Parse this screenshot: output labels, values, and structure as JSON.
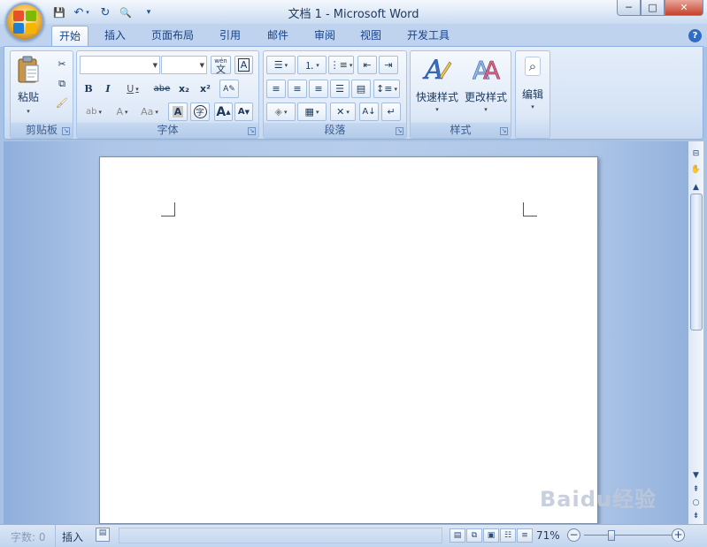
{
  "window": {
    "title": "文档 1 - Microsoft Word"
  },
  "quick_access": {
    "save": "💾",
    "undo": "↶",
    "redo": "↻",
    "preview": "🔍",
    "customize": "▾"
  },
  "window_controls": {
    "minimize": "─",
    "maximize": "□",
    "close": "✕"
  },
  "tabs": [
    {
      "label": "开始"
    },
    {
      "label": "插入"
    },
    {
      "label": "页面布局"
    },
    {
      "label": "引用"
    },
    {
      "label": "邮件"
    },
    {
      "label": "审阅"
    },
    {
      "label": "视图"
    },
    {
      "label": "开发工具"
    }
  ],
  "ribbon": {
    "clipboard": {
      "label": "剪贴板",
      "paste": "粘贴"
    },
    "font": {
      "label": "字体",
      "font_name": "",
      "font_size": "",
      "bold": "B",
      "italic": "I",
      "underline": "U",
      "strike": "abe",
      "subscript": "x₂",
      "superscript": "x²",
      "grow": "A",
      "shrink": "A",
      "phonetic": "wén",
      "char_border": "A",
      "char_shade": "A",
      "enclose": "字"
    },
    "paragraph": {
      "label": "段落"
    },
    "styles": {
      "label": "样式",
      "quick_styles": "快速样式",
      "change_styles": "更改样式"
    },
    "editing": {
      "label": "编辑"
    }
  },
  "status": {
    "word_count": "字数: 0",
    "insert_mode": "插入",
    "zoom": "71%"
  },
  "watermark": "Baidu经验",
  "colors": {
    "accent": "#15428b",
    "ribbon_bg": "#dbe7f6",
    "doc_bg": "#b7cdeb"
  }
}
